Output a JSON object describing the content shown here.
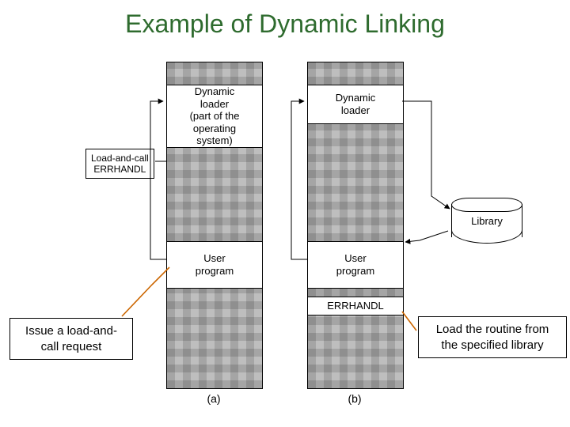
{
  "title": "Example of Dynamic Linking",
  "colA": {
    "seg_loader": "Dynamic\nloader\n(part of the\noperating\nsystem)",
    "seg_user": "User\nprogram",
    "lac_label": "Load-and-call\nERRHANDL",
    "sub": "(a)"
  },
  "colB": {
    "seg_loader": "Dynamic\nloader",
    "seg_user": "User\nprogram",
    "seg_err": "ERRHANDL",
    "sub": "(b)"
  },
  "library": "Library",
  "captions": {
    "left": "Issue a load-and-\ncall request",
    "right": "Load the routine from\nthe specified library"
  },
  "colors": {
    "title": "#2e6b2e",
    "pointer": "#cc6600"
  }
}
